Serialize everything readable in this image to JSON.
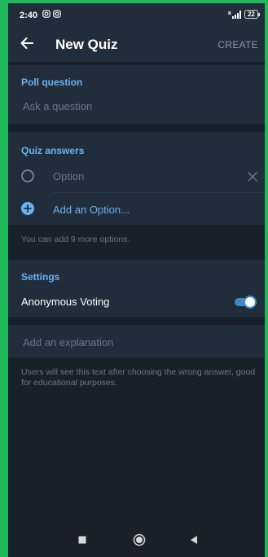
{
  "status_bar": {
    "time": "2:40",
    "battery": "22"
  },
  "toolbar": {
    "title": "New Quiz",
    "create_label": "CREATE"
  },
  "poll_question": {
    "section_title": "Poll question",
    "placeholder": "Ask a question"
  },
  "quiz_answers": {
    "section_title": "Quiz answers",
    "option_placeholder": "Option",
    "add_option_label": "Add an Option...",
    "hint": "You can add 9 more options."
  },
  "settings": {
    "section_title": "Settings",
    "anonymous_voting_label": "Anonymous Voting",
    "anonymous_voting_enabled": true
  },
  "explanation": {
    "placeholder": "Add an explanation",
    "hint": "Users will see this text after choosing the wrong answer, good for educational purposes."
  },
  "colors": {
    "background": "#182029",
    "card": "#212d3b",
    "accent": "#6ab3f3",
    "toggle": "#3e88c7",
    "muted_text": "#6d7883",
    "frame": "#1fb85a"
  },
  "icons": {
    "back": "arrow-left-icon",
    "radio": "radio-empty-icon",
    "remove": "close-icon",
    "add": "plus-circle-icon",
    "nav_recents": "square-icon",
    "nav_home": "circle-icon",
    "nav_back": "triangle-back-icon"
  }
}
